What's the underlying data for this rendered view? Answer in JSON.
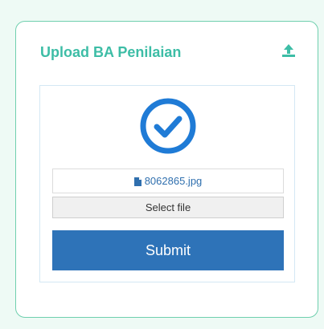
{
  "card": {
    "title": "Upload BA Penilaian"
  },
  "upload": {
    "file_name": "8062865.jpg",
    "select_label": "Select file",
    "submit_label": "Submit"
  },
  "icons": {
    "header": "upload-icon",
    "status": "check-circle-icon",
    "file": "file-icon"
  },
  "colors": {
    "title": "#3dbda6",
    "accent": "#2e73b8",
    "status": "#1f7bd6"
  }
}
